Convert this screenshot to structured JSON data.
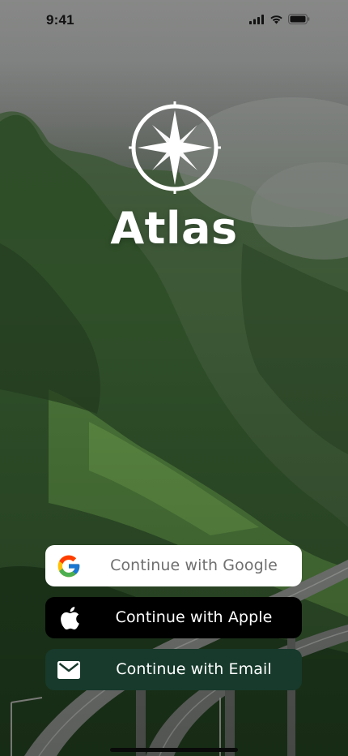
{
  "status_bar": {
    "time": "9:41",
    "icons": [
      "cellular-signal-icon",
      "wifi-icon",
      "battery-icon"
    ]
  },
  "app": {
    "name": "Atlas",
    "logo_icon": "compass-rose-icon"
  },
  "auth": {
    "google": {
      "label": "Continue with Google",
      "icon": "google-logo-icon"
    },
    "apple": {
      "label": "Continue with Apple",
      "icon": "apple-logo-icon"
    },
    "email": {
      "label": "Continue with Email",
      "icon": "mail-icon"
    }
  },
  "colors": {
    "google_button_bg": "#ffffff",
    "apple_button_bg": "#000000",
    "email_button_bg": "#173a2c",
    "title_color": "#ffffff"
  }
}
